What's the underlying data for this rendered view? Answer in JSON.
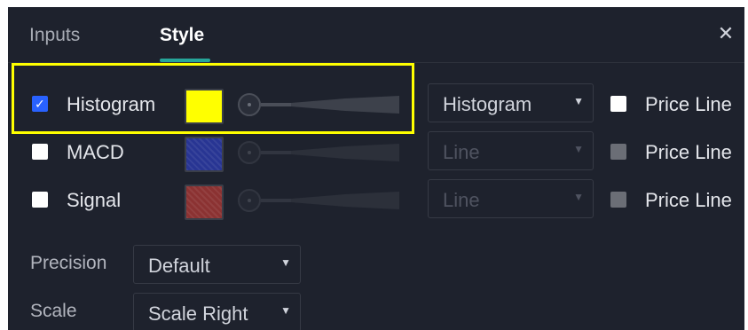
{
  "tabs": [
    {
      "label": "Inputs",
      "active": false
    },
    {
      "label": "Style",
      "active": true
    }
  ],
  "close_icon": "close-icon",
  "plots": [
    {
      "label": "Histogram",
      "checked": true,
      "color": "#ffff00",
      "plot_type": "Histogram",
      "plot_type_enabled": true,
      "price_line_label": "Price Line",
      "price_line_checked": false,
      "price_line_enabled": true
    },
    {
      "label": "MACD",
      "checked": false,
      "color": "#283593",
      "plot_type": "Line",
      "plot_type_enabled": false,
      "price_line_label": "Price Line",
      "price_line_checked": false,
      "price_line_enabled": false
    },
    {
      "label": "Signal",
      "checked": false,
      "color": "#8b3232",
      "plot_type": "Line",
      "plot_type_enabled": false,
      "price_line_label": "Price Line",
      "price_line_checked": false,
      "price_line_enabled": false
    }
  ],
  "precision": {
    "label": "Precision",
    "value": "Default"
  },
  "scale": {
    "label": "Scale",
    "value": "Scale Right"
  },
  "colors": {
    "background": "#1e222d",
    "accent_tab": "#26a69a",
    "checkbox_checked": "#2962ff",
    "highlight": "#ffff00"
  }
}
